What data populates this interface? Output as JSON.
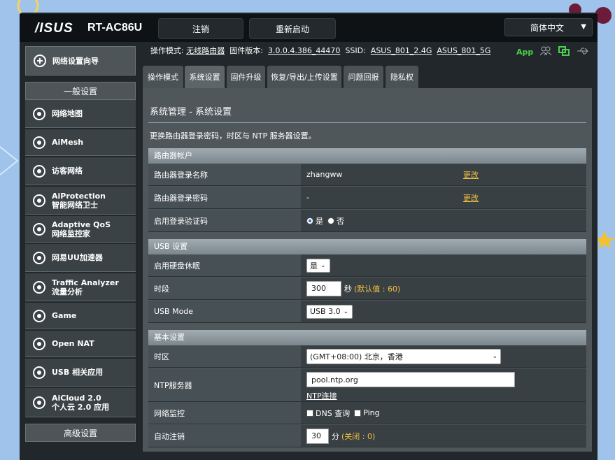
{
  "header": {
    "logo": "/ISUS",
    "model": "RT-AC86U",
    "logout": "注销",
    "reboot": "重新启动",
    "language": "简体中文"
  },
  "infobar": {
    "mode_label": "操作模式:",
    "mode_value": "无线路由器",
    "firmware_label": "固件版本:",
    "firmware_value": "3.0.0.4.386_44470",
    "ssid_label": "SSID:",
    "ssid_24": "ASUS_801_2.4G",
    "ssid_5": "ASUS_801_5G",
    "app": "App"
  },
  "sidebar": {
    "wizard": "网络设置向导",
    "general_title": "一般设置",
    "items": [
      {
        "line1": "网络地图",
        "line2": ""
      },
      {
        "line1": "AiMesh",
        "line2": ""
      },
      {
        "line1": "访客网络",
        "line2": ""
      },
      {
        "line1": "AiProtection",
        "line2": "智能网络卫士"
      },
      {
        "line1": "Adaptive QoS",
        "line2": "网络监控家"
      },
      {
        "line1": "网易UU加速器",
        "line2": ""
      },
      {
        "line1": "Traffic Analyzer",
        "line2": "流量分析"
      },
      {
        "line1": "Game",
        "line2": ""
      },
      {
        "line1": "Open NAT",
        "line2": ""
      },
      {
        "line1": "USB 相关应用",
        "line2": ""
      },
      {
        "line1": "AiCloud 2.0",
        "line2": "个人云 2.0 应用"
      }
    ],
    "advanced_title": "高级设置"
  },
  "tabs": [
    "操作模式",
    "系统设置",
    "固件升级",
    "恢复/导出/上传设置",
    "问题回报",
    "隐私权"
  ],
  "page": {
    "title": "系统管理 - 系统设置",
    "desc": "更换路由器登录密码，时区与 NTP 服务器设置。"
  },
  "sections": {
    "account": {
      "title": "路由器帐户",
      "login_name_label": "路由器登录名称",
      "login_name_value": "zhangww",
      "login_pwd_label": "路由器登录密码",
      "login_pwd_value": "-",
      "change": "更改",
      "captcha_label": "启用登录验证码",
      "yes": "是",
      "no": "否"
    },
    "usb": {
      "title": "USB 设置",
      "hdd_label": "启用硬盘休眠",
      "hdd_value": "是",
      "period_label": "时段",
      "period_value": "300",
      "period_unit": "秒",
      "period_hint": "(默认值 : 60)",
      "mode_label": "USB Mode",
      "mode_value": "USB 3.0"
    },
    "basic": {
      "title": "基本设置",
      "tz_label": "时区",
      "tz_value": "(GMT+08:00) 北京，香港",
      "ntp_label": "NTP服务器",
      "ntp_value": "pool.ntp.org",
      "ntp_link": "NTP连接",
      "monitor_label": "网络监控",
      "dns": "DNS 查询",
      "ping": "Ping",
      "logout_label": "自动注销",
      "logout_value": "30",
      "logout_unit": "分",
      "logout_hint": "(关闭 : 0)"
    }
  }
}
